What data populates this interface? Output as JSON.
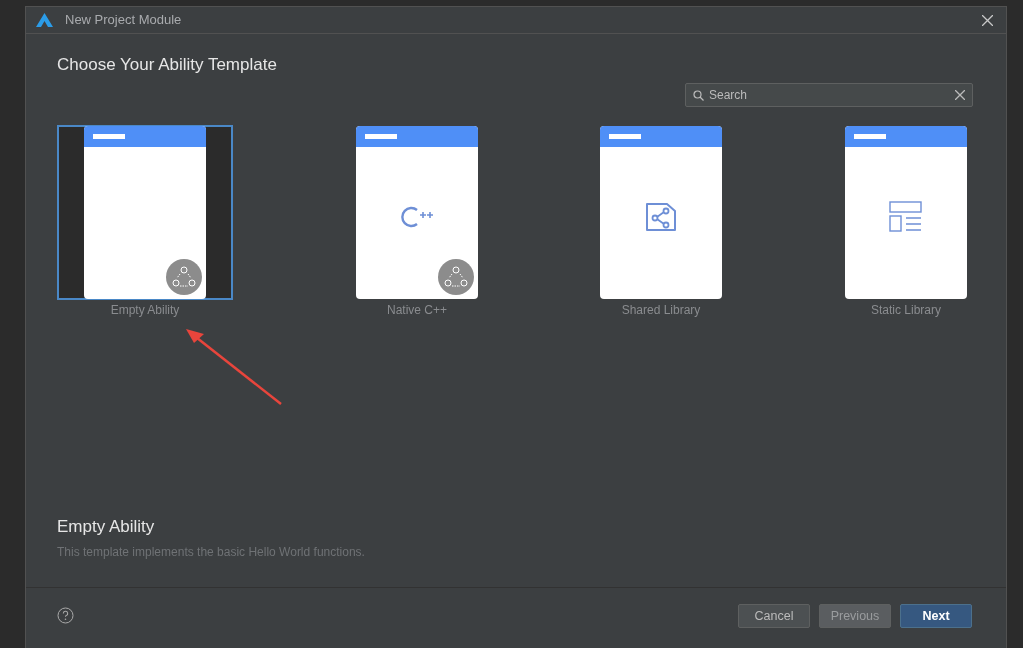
{
  "window": {
    "title": "New Project Module"
  },
  "heading": "Choose Your Ability Template",
  "search": {
    "placeholder": "Search"
  },
  "templates": [
    {
      "name": "Empty Ability",
      "kind": "empty",
      "badge": true,
      "selected": true
    },
    {
      "name": "Native C++",
      "kind": "cpp",
      "badge": true,
      "selected": false
    },
    {
      "name": "Shared Library",
      "kind": "shared",
      "badge": false,
      "selected": false
    },
    {
      "name": "Static Library",
      "kind": "static",
      "badge": false,
      "selected": false
    }
  ],
  "description": {
    "title": "Empty Ability",
    "text": "This template implements the basic Hello World functions."
  },
  "buttons": [
    {
      "label": "Cancel",
      "kind": "secondary",
      "disabled": false
    },
    {
      "label": "Previous",
      "kind": "secondary",
      "disabled": true
    },
    {
      "label": "Next",
      "kind": "primary",
      "disabled": false
    }
  ]
}
